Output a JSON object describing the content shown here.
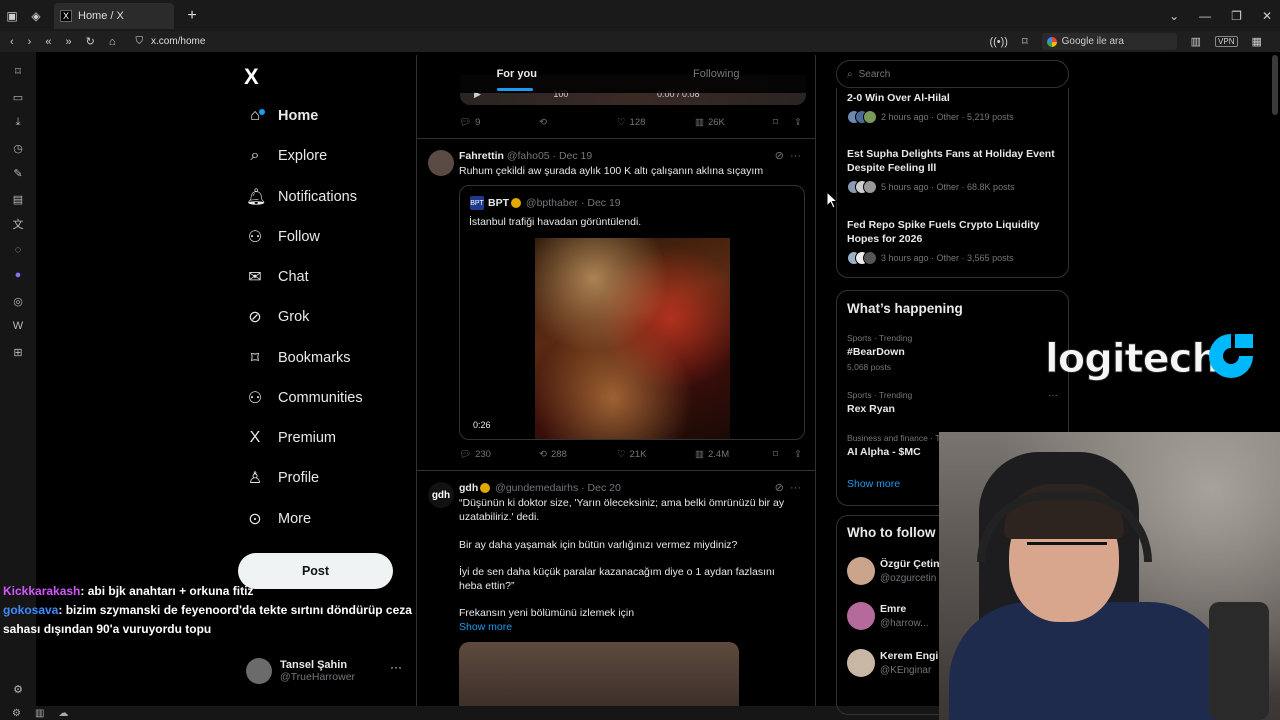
{
  "browser": {
    "tab_title": "Home / X",
    "url": "x.com/home",
    "search_placeholder": "Google ile ara",
    "vpn_label": "VPN"
  },
  "nav": {
    "logo": "X",
    "items": [
      {
        "label": "Home",
        "icon": "home-icon"
      },
      {
        "label": "Explore",
        "icon": "search-icon"
      },
      {
        "label": "Notifications",
        "icon": "bell-icon"
      },
      {
        "label": "Follow",
        "icon": "follow-icon"
      },
      {
        "label": "Chat",
        "icon": "mail-icon"
      },
      {
        "label": "Grok",
        "icon": "grok-icon"
      },
      {
        "label": "Bookmarks",
        "icon": "bookmark-icon"
      },
      {
        "label": "Communities",
        "icon": "people-icon"
      },
      {
        "label": "Premium",
        "icon": "x-icon"
      },
      {
        "label": "Profile",
        "icon": "person-icon"
      },
      {
        "label": "More",
        "icon": "more-circle-icon"
      }
    ],
    "post_label": "Post",
    "profile": {
      "name": "Tansel Şahin",
      "handle": "@TrueHarrower"
    }
  },
  "chat_overlay": [
    {
      "user": "Kickkarakash",
      "text": ": abi bjk anahtarı + orkuna fitiz"
    },
    {
      "user": "gokosava",
      "text": ": bizim szymanski de feyenoord'da tekte sırtını döndürüp ceza sahası dışından 90'a vuruyordu topu"
    }
  ],
  "timeline": {
    "tabs": [
      "For you",
      "Following"
    ],
    "video_strip": {
      "time": "0:00 / 0:08",
      "mark": "100"
    },
    "top_actions": {
      "replies": "9",
      "likes": "128",
      "views": "26K"
    },
    "tweet1": {
      "name": "Fahrettin",
      "handle": "@faho05",
      "date": "· Dec 19",
      "text": "Ruhum çekildi aw şurada aylık 100 K altı çalışanın aklına sıçayım",
      "quote": {
        "logo": "BPT",
        "name": "BPT",
        "handle": "@bpthaber",
        "date": "· Dec 19",
        "text": "İstanbul trafiği havadan görüntülendi.",
        "duration": "0:26"
      },
      "actions": {
        "replies": "230",
        "reposts": "288",
        "likes": "21K",
        "views": "2.4M"
      }
    },
    "tweet2": {
      "avatar": "gdh",
      "name": "gdh",
      "handle": "@gundemedairhs",
      "date": "· Dec 20",
      "p1": "“Düşünün ki doktor size, 'Yarın öleceksiniz; ama belki ömrünüzü bir ay uzatabiliriz.' dedi.",
      "p2": "Bir ay daha yaşamak için bütün varlığınızı vermez miydiniz?",
      "p3": "İyi de sen daha küçük paralar kazanacağım diye o 1 aydan fazlasını heba ettin?”",
      "p4": "Frekansın yeni bölümünü izlemek için",
      "show_more": "Show more"
    }
  },
  "sidebar": {
    "search_placeholder": "Search",
    "news": [
      {
        "title": "2-0 Win Over Al-Hilal",
        "meta": "2 hours ago · Other · 5,219 posts"
      },
      {
        "title": "Est Supha Delights Fans at Holiday Event Despite Feeling Ill",
        "meta": "5 hours ago · Other · 68.8K posts"
      },
      {
        "title": "Fed Repo Spike Fuels Crypto Liquidity Hopes for 2026",
        "meta": "3 hours ago · Other · 3,565 posts"
      }
    ],
    "happening": {
      "title": "What’s happening",
      "trends": [
        {
          "cat": "Sports · Trending",
          "name": "#BearDown",
          "posts": "5,068 posts"
        },
        {
          "cat": "Sports · Trending",
          "name": "Rex Ryan",
          "posts": ""
        },
        {
          "cat": "Business and finance · Tr",
          "name": "AI Alpha - $MC",
          "posts": ""
        }
      ],
      "show_more": "Show more"
    },
    "who_to_follow": {
      "title": "Who to follow",
      "users": [
        {
          "name": "Özgür Çetin",
          "handle": "@ozgurcetin"
        },
        {
          "name": "Emre",
          "handle": "@harrow..."
        },
        {
          "name": "Kerem Engin",
          "handle": "@KEnginar"
        }
      ]
    }
  },
  "overlay": {
    "brand": "logitech"
  },
  "colors": {
    "accent": "#1d9bf0",
    "bg": "#000000",
    "text": "#e7e9ea",
    "muted": "#71767b",
    "border": "#2f3336"
  }
}
